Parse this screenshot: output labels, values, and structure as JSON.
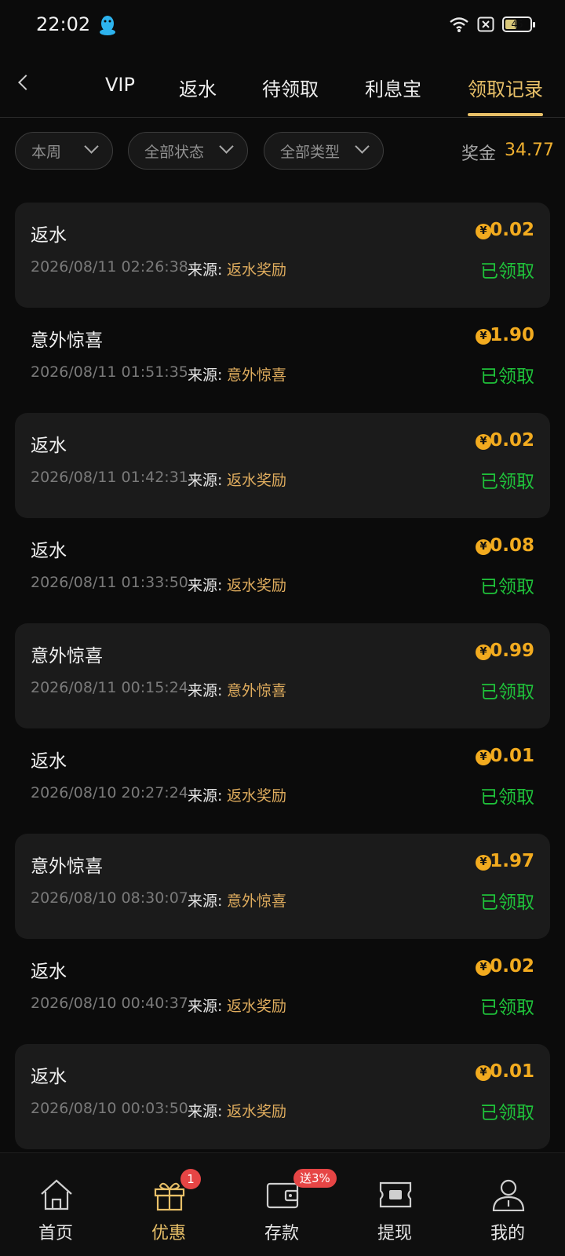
{
  "status_bar": {
    "time": "22:02",
    "battery": "45"
  },
  "nav": {
    "tabs": [
      {
        "label": "VIP"
      },
      {
        "label": "返水"
      },
      {
        "label": "待领取"
      },
      {
        "label": "利息宝"
      },
      {
        "label": "领取记录"
      }
    ],
    "active_tab": "领取记录"
  },
  "filters": {
    "period": "本周",
    "status": "全部状态",
    "type": "全部类型",
    "bonus_label": "奖金",
    "bonus_value": "34.77"
  },
  "records": [
    {
      "title": "返水",
      "time": "2026/08/11 02:26:38",
      "source_label": "来源:",
      "source": "返水奖励",
      "amount": "0.02",
      "status": "已领取"
    },
    {
      "title": "意外惊喜",
      "time": "2026/08/11 01:51:35",
      "source_label": "来源:",
      "source": "意外惊喜",
      "amount": "1.90",
      "status": "已领取"
    },
    {
      "title": "返水",
      "time": "2026/08/11 01:42:31",
      "source_label": "来源:",
      "source": "返水奖励",
      "amount": "0.02",
      "status": "已领取"
    },
    {
      "title": "返水",
      "time": "2026/08/11 01:33:50",
      "source_label": "来源:",
      "source": "返水奖励",
      "amount": "0.08",
      "status": "已领取"
    },
    {
      "title": "意外惊喜",
      "time": "2026/08/11 00:15:24",
      "source_label": "来源:",
      "source": "意外惊喜",
      "amount": "0.99",
      "status": "已领取"
    },
    {
      "title": "返水",
      "time": "2026/08/10 20:27:24",
      "source_label": "来源:",
      "source": "返水奖励",
      "amount": "0.01",
      "status": "已领取"
    },
    {
      "title": "意外惊喜",
      "time": "2026/08/10 08:30:07",
      "source_label": "来源:",
      "source": "意外惊喜",
      "amount": "1.97",
      "status": "已领取"
    },
    {
      "title": "返水",
      "time": "2026/08/10 00:40:37",
      "source_label": "来源:",
      "source": "返水奖励",
      "amount": "0.02",
      "status": "已领取"
    },
    {
      "title": "返水",
      "time": "2026/08/10 00:03:50",
      "source_label": "来源:",
      "source": "返水奖励",
      "amount": "0.01",
      "status": "已领取"
    }
  ],
  "currency_symbol": "¥",
  "bottom_nav": {
    "items": [
      {
        "label": "首页",
        "icon": "home-icon"
      },
      {
        "label": "优惠",
        "icon": "gift-icon"
      },
      {
        "label": "存款",
        "icon": "wallet-icon"
      },
      {
        "label": "提现",
        "icon": "withdraw-icon"
      },
      {
        "label": "我的",
        "icon": "profile-icon"
      }
    ],
    "active": "优惠",
    "promo_badge": "1",
    "deposit_badge": "送3%"
  },
  "colors": {
    "accent": "#e8c068",
    "amount": "#f2ab1f",
    "claimed": "#1fc23a",
    "source": "#e0ad5e",
    "badge": "#e64545"
  }
}
